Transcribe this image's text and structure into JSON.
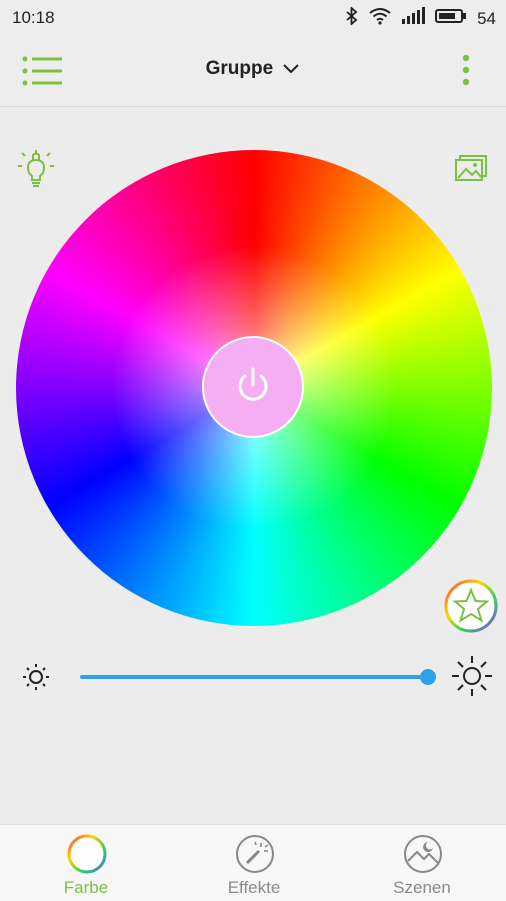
{
  "status": {
    "time": "10:18",
    "battery": "54"
  },
  "header": {
    "title": "Gruppe"
  },
  "colors": {
    "accent": "#7ac143",
    "slider": "#2fa0e4",
    "power_bg": "#f6aef2"
  },
  "icons": {
    "menu": "list-icon",
    "more": "more-vert-icon",
    "bulb": "bulb-icon",
    "image": "image-icon",
    "favorite": "star-icon",
    "brightness_low": "sun-small-icon",
    "brightness_high": "sun-large-icon",
    "power": "power-icon"
  },
  "brightness": {
    "value": 1.0
  },
  "bottom_nav": {
    "farbe": {
      "label": "Farbe",
      "active": true
    },
    "effekte": {
      "label": "Effekte"
    },
    "szenen": {
      "label": "Szenen"
    }
  }
}
